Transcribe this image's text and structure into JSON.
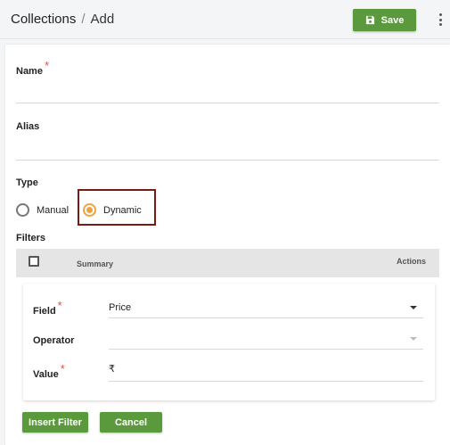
{
  "header": {
    "breadcrumb": [
      "Collections",
      "/",
      "Add"
    ],
    "save_label": "Save",
    "save_icon": "floppy-disk-icon",
    "menu_icon": "kebab-menu-icon"
  },
  "form": {
    "name_label": "Name",
    "alias_label": "Alias",
    "required_mark": "*",
    "type_label": "Type",
    "type_options": [
      {
        "label": "Manual",
        "selected": false
      },
      {
        "label": "Dynamic",
        "selected": true
      }
    ],
    "filters_label": "Filters"
  },
  "filters_table": {
    "columns": [
      "Summary",
      "Actions"
    ]
  },
  "filter_editor": {
    "field_label": "Field",
    "field_value": "Price",
    "operator_label": "Operator",
    "operator_value": "",
    "value_label": "Value",
    "value_prefix": "₹"
  },
  "actions": {
    "insert_label": "Insert Filter",
    "cancel_label": "Cancel"
  },
  "colors": {
    "primary_button": "#5a9a3c",
    "radio_selected": "#f0a33a",
    "required": "#e0533a",
    "highlight_border": "#7a1a12"
  }
}
